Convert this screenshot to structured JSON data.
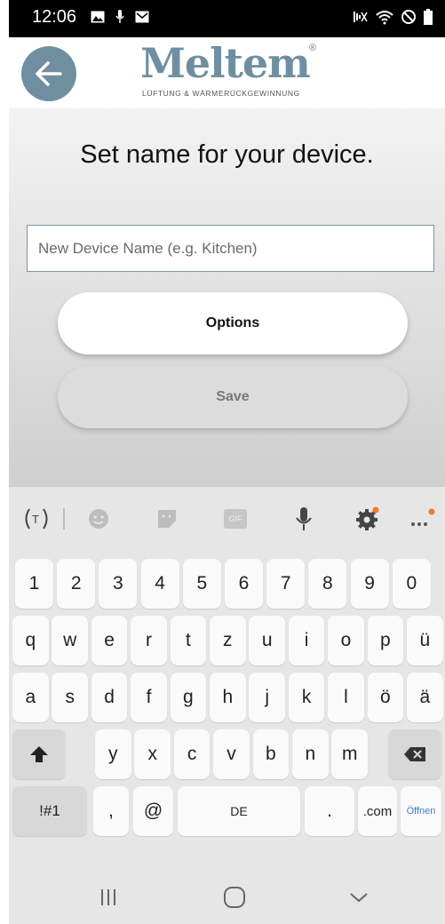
{
  "status": {
    "time": "12:06"
  },
  "header": {
    "logo_word": "Meltem",
    "logo_reg": "®",
    "logo_tagline": "LÜFTUNG & WÄRMERÜCKGEWINNUNG"
  },
  "main": {
    "title": "Set name for your device.",
    "input_placeholder": "New Device Name (e.g. Kitchen)",
    "input_value": "",
    "options_label": "Options",
    "save_label": "Save"
  },
  "keyboard": {
    "toolbar": [
      "translate-icon",
      "emoji-icon",
      "sticker-icon",
      "gif-icon",
      "microphone-icon",
      "settings-icon",
      "more-icon"
    ],
    "toolbar_gif": "GIF",
    "row1": [
      "1",
      "2",
      "3",
      "4",
      "5",
      "6",
      "7",
      "8",
      "9",
      "0"
    ],
    "row2": [
      "q",
      "w",
      "e",
      "r",
      "t",
      "z",
      "u",
      "i",
      "o",
      "p",
      "ü"
    ],
    "row3": [
      "a",
      "s",
      "d",
      "f",
      "g",
      "h",
      "j",
      "k",
      "l",
      "ö",
      "ä"
    ],
    "row4": [
      "y",
      "x",
      "c",
      "v",
      "b",
      "n",
      "m"
    ],
    "symbols_label": "!#1",
    "comma_label": ",",
    "at_label": "@",
    "space_label": "DE",
    "period_label": ".",
    "dotcom_label": ".com",
    "enter_label": "Öffnen",
    "accent_color": "#f07b2a"
  },
  "navbar": [
    "recent-apps-icon",
    "home-icon",
    "back-nav-icon"
  ]
}
